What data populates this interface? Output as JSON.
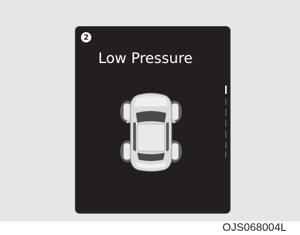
{
  "display": {
    "badge_number": "2",
    "title": "Low Pressure",
    "icon": "car-top-view-tire-icon",
    "scroll_position": 0.08
  },
  "caption": "OJS068004L",
  "colors": {
    "screen_bg": "#231f20",
    "frame_bg": "#e6e6e6",
    "text": "#ffffff",
    "car_body": "#d9d9d9",
    "tire_glow": "#6d6d6d"
  }
}
